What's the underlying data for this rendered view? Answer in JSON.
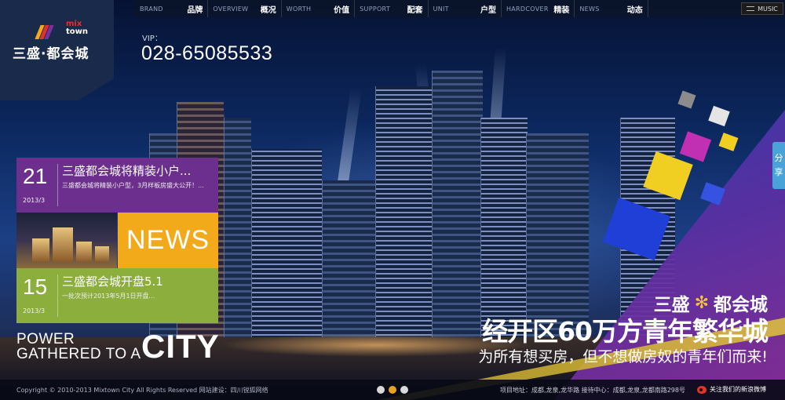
{
  "nav": [
    {
      "en": "BRAND",
      "cn": "品牌"
    },
    {
      "en": "OVERVIEW",
      "cn": "概况"
    },
    {
      "en": "WORTH",
      "cn": "价值"
    },
    {
      "en": "SUPPORT",
      "cn": "配套"
    },
    {
      "en": "UNIT",
      "cn": "户型"
    },
    {
      "en": "HARDCOVER",
      "cn": "精装"
    },
    {
      "en": "NEWS",
      "cn": "动态"
    }
  ],
  "music_label": "MUSIC",
  "logo": {
    "en_line1": "mix",
    "en_line2": "town",
    "cn": "三盛·都会城"
  },
  "vip": {
    "label": "VIP：",
    "phone": "028-65085533"
  },
  "news": [
    {
      "day": "21",
      "date": "2013/3",
      "title": "三盛都会城将精装小户...",
      "summary": "三盛都会城将精装小户型，3月样板房盛大公开！..."
    },
    {
      "day": "15",
      "date": "2013/3",
      "title": "三盛都会城开盘5.1",
      "summary": "一批次预计2013年5月1日开盘..."
    }
  ],
  "news_banner": "NEWS",
  "slogan": {
    "line1": "POWER",
    "line2": "GATHERED TO A",
    "city": "CITY"
  },
  "brand": {
    "left": "三盛",
    "star": "✻",
    "right": "都会城"
  },
  "headline": "经开区60万方青年繁华城",
  "subline": "为所有想买房，但不想做房奴的青年们而来!",
  "share": [
    "分",
    "享"
  ],
  "footer": {
    "copyright": "Copyright © 2010-2013 Mixtown City All Rights Reserved 网站建设：四川锐狐网络",
    "address": "项目地址：成都,龙泉,龙华路  接待中心：成都,龙泉,龙都南路298号",
    "weibo": "关注我们的新浪微博"
  },
  "colors": {
    "purple": "#6c2f8d",
    "orange": "#f2a91a",
    "green": "#8cae3d",
    "nav_bg": "#0a1428"
  }
}
